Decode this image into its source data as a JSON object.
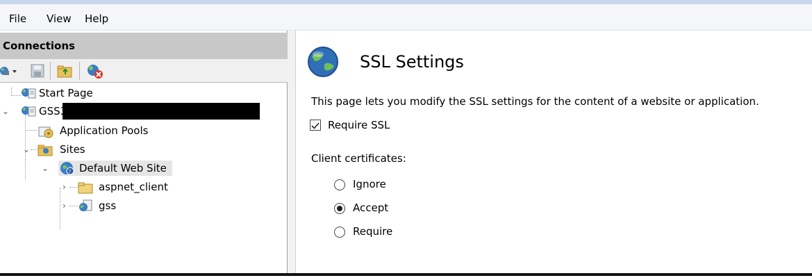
{
  "menu": {
    "file": "File",
    "view": "View",
    "help": "Help"
  },
  "connections": {
    "header": "Connections",
    "toolbar": [
      "connect-icon",
      "save-icon",
      "up-folder-icon",
      "disconnect-icon"
    ]
  },
  "tree": {
    "start_page": "Start Page",
    "server": "GSS3",
    "app_pools": "Application Pools",
    "sites": "Sites",
    "default_site": "Default Web Site",
    "aspnet_client": "aspnet_client",
    "gss": "gss"
  },
  "ssl": {
    "title": "SSL Settings",
    "description": "This page lets you modify the SSL settings for the content of a website or application.",
    "require_ssl_label": "Require SSL",
    "require_ssl_checked": true,
    "client_certs_label": "Client certificates:",
    "options": [
      "Ignore",
      "Accept",
      "Require"
    ],
    "selected_option": "Accept"
  }
}
